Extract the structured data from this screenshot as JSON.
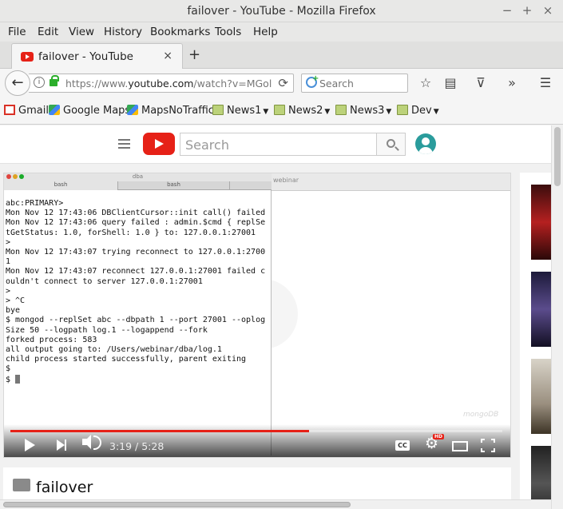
{
  "window": {
    "title": "failover - YouTube - Mozilla Firefox"
  },
  "menu": [
    "File",
    "Edit",
    "View",
    "History",
    "Bookmarks",
    "Tools",
    "Help"
  ],
  "tab": {
    "title": "failover - YouTube",
    "close": "×",
    "new": "+"
  },
  "nav": {
    "url_prefix": "https://www.",
    "url_host": "youtube.com",
    "url_rest": "/watch?v=MGol",
    "search_placeholder": "Search"
  },
  "bookmarks": [
    {
      "label": "Gmail",
      "icon": "gmail-icon"
    },
    {
      "label": "Google Maps",
      "icon": "maps-icon"
    },
    {
      "label": "MapsNoTraffic",
      "icon": "maps-icon"
    },
    {
      "label": "News1",
      "icon": "folder-icon"
    },
    {
      "label": "News2",
      "icon": "folder-icon"
    },
    {
      "label": "News3",
      "icon": "folder-icon"
    },
    {
      "label": "Dev",
      "icon": "folder-icon"
    }
  ],
  "youtube": {
    "search_placeholder": "Search",
    "video_title": "failover",
    "watermark": "mongoDB",
    "player": {
      "current_time": "3:19",
      "duration": "5:28",
      "time_text": "3:19 / 5:28",
      "progress": 0.607,
      "hd_badge": "HD",
      "cc_label": "CC"
    }
  },
  "terminal": {
    "window_title": "dba",
    "tabs": [
      "bash",
      "bash"
    ],
    "side_label": "webinar",
    "lines": [
      "abc:PRIMARY>",
      "Mon Nov 12 17:43:06 DBClientCursor::init call() failed",
      "Mon Nov 12 17:43:06 query failed : admin.$cmd { replSe",
      "tGetStatus: 1.0, forShell: 1.0 } to: 127.0.0.1:27001",
      ">",
      "Mon Nov 12 17:43:07 trying reconnect to 127.0.0.1:2700",
      "1",
      "Mon Nov 12 17:43:07 reconnect 127.0.0.1:27001 failed c",
      "ouldn't connect to server 127.0.0.1:27001",
      ">",
      "> ^C",
      "bye",
      "$ mongod --replSet abc --dbpath 1 --port 27001 --oplog",
      "Size 50 --logpath log.1 --logappend --fork",
      "forked process: 583",
      "all output going to: /Users/webinar/dba/log.1",
      "child process started successfully, parent exiting",
      "$",
      "$ "
    ]
  },
  "colors": {
    "youtube_red": "#e62117",
    "progress_red": "#e62117",
    "lock_green": "#2bae2b"
  }
}
